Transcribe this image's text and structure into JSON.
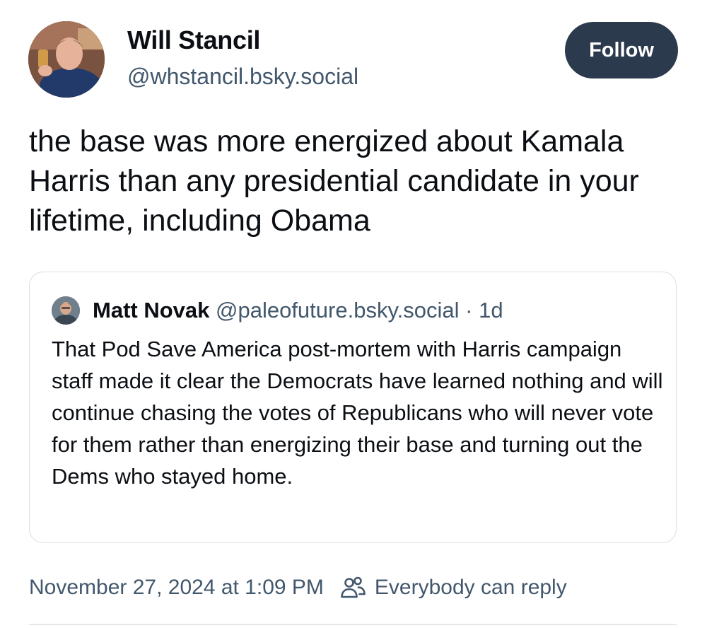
{
  "author": {
    "display_name": "Will Stancil",
    "handle": "@whstancil.bsky.social",
    "avatar_icon": "profile-photo"
  },
  "follow_button": {
    "label": "Follow",
    "background": "#2b3a4d"
  },
  "post": {
    "text": "the base was more energized about Kamala Harris than any presidential candidate in your lifetime, including Obama"
  },
  "quoted_post": {
    "display_name": "Matt Novak",
    "handle": "@paleofuture.bsky.social",
    "separator": " · ",
    "age": "1d",
    "text": "That Pod Save America post-mortem with Harris campaign staff made it clear the Democrats have learned nothing and will continue chasing the votes of Republicans who will never vote for them rather than energizing their base and turning out the Dems who stayed home."
  },
  "meta": {
    "timestamp": "November 27, 2024 at 1:09 PM",
    "reply_setting": "Everybody can reply",
    "reply_icon": "people-icon"
  },
  "colors": {
    "text_primary": "#0b0f14",
    "text_secondary": "#42576c",
    "border": "#d9dee4"
  }
}
